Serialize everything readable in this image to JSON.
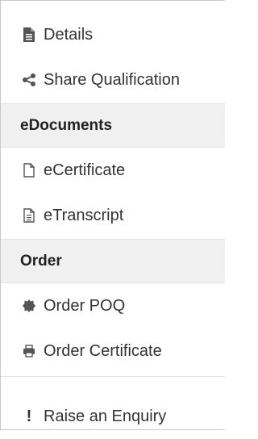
{
  "menu": {
    "items_top": [
      {
        "label": "Details",
        "icon": "document-icon"
      },
      {
        "label": "Share Qualification",
        "icon": "share-icon"
      }
    ],
    "sections": [
      {
        "title": "eDocuments",
        "items": [
          {
            "label": "eCertificate",
            "icon": "blank-document-icon"
          },
          {
            "label": "eTranscript",
            "icon": "text-document-icon"
          }
        ]
      },
      {
        "title": "Order",
        "items": [
          {
            "label": "Order POQ",
            "icon": "badge-icon"
          },
          {
            "label": "Order Certificate",
            "icon": "printer-icon"
          }
        ]
      }
    ],
    "enquiry": {
      "label": "Raise an Enquiry",
      "icon": "exclamation-icon",
      "glyph": "!"
    }
  }
}
